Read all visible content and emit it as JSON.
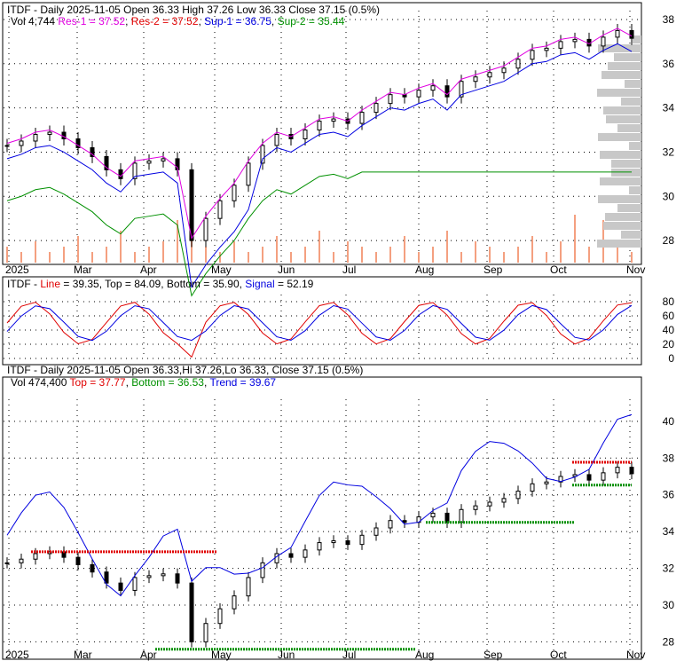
{
  "chart_data": [
    {
      "type": "candlestick",
      "title": "ITDF - Daily 2025-11-05 Open 36.33  High 37.26  Low 36.33  Close 37.15 (0.5%)",
      "legend": {
        "vol": "Vol 4,744",
        "res1": "Res-1 = 37.52",
        "res2": "Res-2 = 37.52",
        "sup1": "Sup-1 = 36.75",
        "sup2": "Sup-2 = 35.44"
      },
      "ylim": [
        27,
        38.4
      ],
      "yticks": [
        "28",
        "30",
        "32",
        "34",
        "36",
        "38"
      ],
      "xticks": [
        "2025",
        "Mar",
        "Apr",
        "May",
        "Jun",
        "Jul",
        "Aug",
        "Sep",
        "Oct",
        "Nov"
      ],
      "closes": [
        32.3,
        32.5,
        32.8,
        32.9,
        32.6,
        32.2,
        31.8,
        31.2,
        30.8,
        31.5,
        31.6,
        31.7,
        31.2,
        28.0,
        29.0,
        29.8,
        30.5,
        31.5,
        32.3,
        32.8,
        32.6,
        33.0,
        33.4,
        33.5,
        33.3,
        33.8,
        34.2,
        34.6,
        34.5,
        34.8,
        35.0,
        34.5,
        35.2,
        35.4,
        35.6,
        35.8,
        36.2,
        36.6,
        36.7,
        37.0,
        37.1,
        36.8,
        37.2,
        37.5,
        37.15
      ],
      "volume": [
        3,
        2,
        4,
        2,
        3,
        5,
        2,
        3,
        6,
        2,
        3,
        4,
        8,
        5,
        3,
        2,
        4,
        2,
        3,
        5,
        2,
        3,
        6,
        2,
        4,
        3,
        2,
        3,
        5,
        2,
        3,
        6,
        2,
        4,
        3,
        2,
        3,
        5,
        2,
        4,
        9,
        3,
        8,
        4,
        2
      ]
    },
    {
      "type": "line",
      "title": "ITDF - Line = 39.35, Top = 84.09, Bottom = 35.90, Signal = 52.19",
      "legend": {
        "prefix": "ITDF - ",
        "line": "Line",
        "line_v": " = 39.35, Top = 84.09, Bottom = 35.90, ",
        "signal": "Signal",
        "signal_v": " = 52.19"
      },
      "ylim": [
        0,
        90
      ],
      "yticks": [
        "0",
        "20",
        "40",
        "60",
        "80"
      ]
    },
    {
      "type": "candlestick",
      "title": "ITDF - Daily 2025-11-05 Open 36.33,Hi 37.26,Lo 36.33, Close 37.15 (0.5%)",
      "legend": {
        "vol": "Vol 474,400 ",
        "top": "Top = 37.77",
        "bottom": "Bottom = 36.53",
        "trend": "Trend = 39.67"
      },
      "ylim": [
        27.2,
        41.2
      ],
      "yticks": [
        "28",
        "30",
        "32",
        "34",
        "36",
        "38",
        "40"
      ]
    }
  ]
}
